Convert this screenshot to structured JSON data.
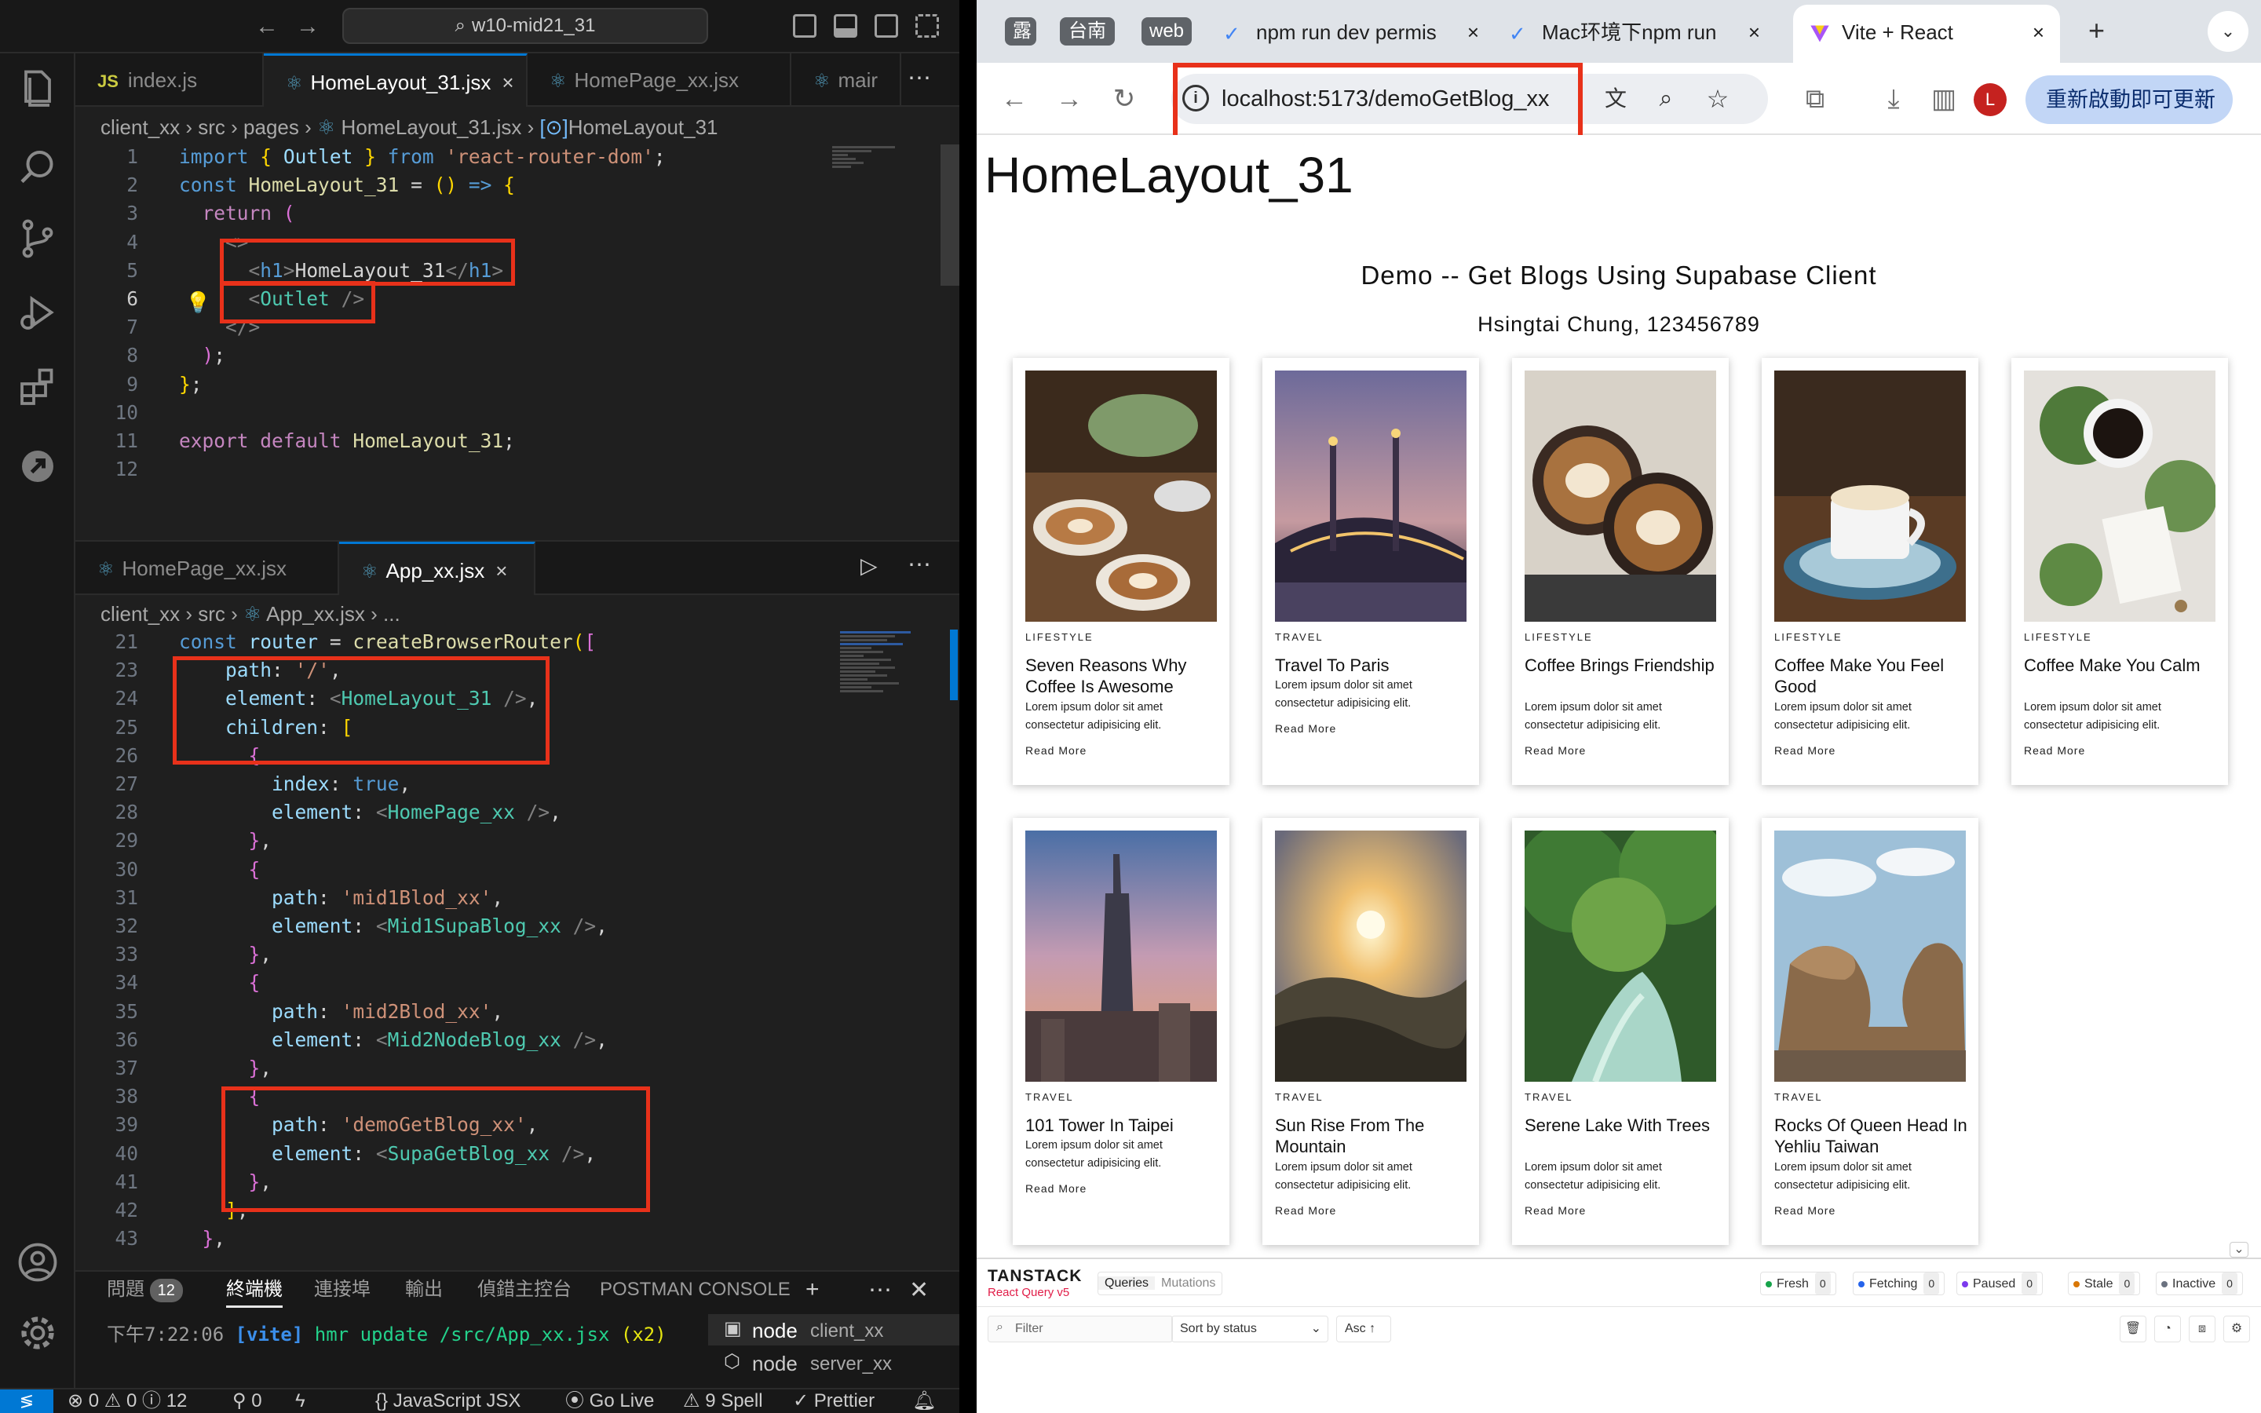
{
  "vscode": {
    "titlebar": {
      "search_text": "w10-mid21_31"
    },
    "editor1": {
      "tabs": [
        {
          "icon": "JS",
          "label": "index.js"
        },
        {
          "label": "HomeLayout_31.jsx",
          "close": "×"
        },
        {
          "label": "HomePage_xx.jsx"
        },
        {
          "label": "mair"
        }
      ],
      "breadcrumb": [
        "client_xx",
        "src",
        "pages",
        "HomeLayout_31.jsx",
        "HomeLayout_31"
      ],
      "line_numbers": [
        "1",
        "2",
        "3",
        "4",
        "5",
        "6",
        "7",
        "8",
        "9",
        "10",
        "11",
        "12"
      ],
      "current_line": "6"
    },
    "editor2": {
      "tabs": [
        {
          "label": "HomePage_xx.jsx"
        },
        {
          "label": "App_xx.jsx",
          "close": "×"
        }
      ],
      "breadcrumb": [
        "client_xx",
        "src",
        "App_xx.jsx",
        "..."
      ],
      "line_numbers": [
        "21",
        "23",
        "24",
        "25",
        "26",
        "27",
        "28",
        "29",
        "30",
        "31",
        "32",
        "33",
        "34",
        "35",
        "36",
        "37",
        "38",
        "39",
        "40",
        "41",
        "42",
        "43"
      ]
    },
    "panel": {
      "tabs": [
        "問題",
        "終端機",
        "連接埠",
        "輸出",
        "偵錯主控台",
        "POSTMAN CONSOLE"
      ],
      "problems_count": "12",
      "terminal_line": {
        "time": "下午7:22:06",
        "tag": "[vite]",
        "msg": "hmr update /src/App_xx.jsx",
        "count": "(x2)"
      },
      "terminals": [
        {
          "name": "node",
          "dir": "client_xx"
        },
        {
          "name": "node",
          "dir": "server_xx"
        }
      ]
    },
    "statusbar": {
      "errors": "0",
      "warnings": "0",
      "infos": "12",
      "ports": "0",
      "language": "JavaScript JSX",
      "golive": "Go Live",
      "spell": "9 Spell",
      "prettier": "Prettier"
    }
  },
  "browser": {
    "tab_pills": [
      "露",
      "台南",
      "web"
    ],
    "tabs": [
      {
        "label": "npm run dev permis",
        "close": "×"
      },
      {
        "label": "Mac环境下npm run",
        "close": "×"
      },
      {
        "label": "Vite + React",
        "close": "×"
      }
    ],
    "url": "localhost:5173/demoGetBlog_xx",
    "update_button": "重新啟動即可更新",
    "avatar_letter": "L",
    "page": {
      "h1": "HomeLayout_31",
      "demo_title": "Demo -- Get Blogs Using Supabase Client",
      "author": "Hsingtai Chung, 123456789",
      "cards": [
        {
          "category": "LIFESTYLE",
          "title": "Seven Reasons Why Coffee Is Awesome",
          "desc": "Lorem ipsum dolor sit amet consectetur adipisicing elit.",
          "more": "Read More"
        },
        {
          "category": "TRAVEL",
          "title": "Travel To Paris",
          "desc": "Lorem ipsum dolor sit amet consectetur adipisicing elit.",
          "more": "Read More"
        },
        {
          "category": "LIFESTYLE",
          "title": "Coffee Brings Friendship",
          "desc": "Lorem ipsum dolor sit amet consectetur adipisicing elit.",
          "more": "Read More"
        },
        {
          "category": "LIFESTYLE",
          "title": "Coffee Make You Feel Good",
          "desc": "Lorem ipsum dolor sit amet consectetur adipisicing elit.",
          "more": "Read More"
        },
        {
          "category": "LIFESTYLE",
          "title": "Coffee Make You Calm",
          "desc": "Lorem ipsum dolor sit amet consectetur adipisicing elit.",
          "more": "Read More"
        },
        {
          "category": "TRAVEL",
          "title": "101 Tower In Taipei",
          "desc": "Lorem ipsum dolor sit amet consectetur adipisicing elit.",
          "more": "Read More"
        },
        {
          "category": "TRAVEL",
          "title": "Sun Rise From The Mountain",
          "desc": "Lorem ipsum dolor sit amet consectetur adipisicing elit.",
          "more": "Read More"
        },
        {
          "category": "TRAVEL",
          "title": "Serene Lake With Trees",
          "desc": "Lorem ipsum dolor sit amet consectetur adipisicing elit.",
          "more": "Read More"
        },
        {
          "category": "TRAVEL",
          "title": "Rocks Of Queen Head In Yehliu Taiwan",
          "desc": "Lorem ipsum dolor sit amet consectetur adipisicing elit.",
          "more": "Read More"
        }
      ]
    },
    "devtools": {
      "brand": "TANSTACK",
      "sub": "React Query v5",
      "tabs": [
        "Queries",
        "Mutations"
      ],
      "statuses": [
        {
          "label": "Fresh",
          "count": "0",
          "color": "#16a34a"
        },
        {
          "label": "Fetching",
          "count": "0",
          "color": "#2563eb"
        },
        {
          "label": "Paused",
          "count": "0",
          "color": "#7c3aed"
        },
        {
          "label": "Stale",
          "count": "0",
          "color": "#d97706"
        },
        {
          "label": "Inactive",
          "count": "0",
          "color": "#6b7280"
        }
      ],
      "filter_placeholder": "Filter",
      "sort": "Sort by status",
      "order": "Asc"
    }
  },
  "colors": {
    "highlight": "#e8311a",
    "vscode_bg": "#1f1f1f",
    "accent": "#0078d4"
  }
}
